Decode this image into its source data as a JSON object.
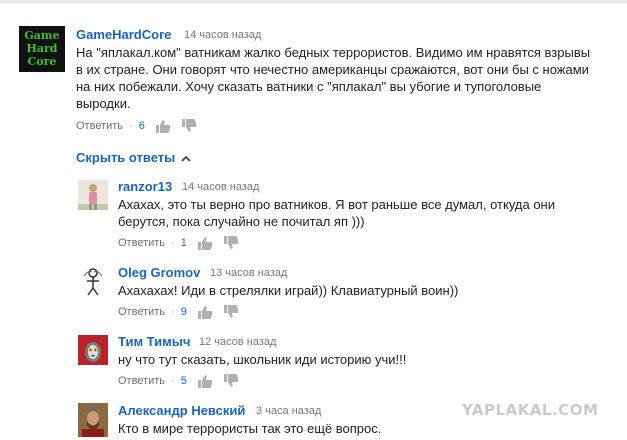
{
  "main_comment": {
    "avatar_text": [
      "Game",
      "Hard",
      "Core"
    ],
    "author": "GameHardCore",
    "time": "14 часов назад",
    "text_lines": [
      "На \"яплакал.ком\" ватникам жалко бедных террористов. Видимо им нравятся взрывы",
      "в их стране. Они говорят что нечестно американцы сражаются, вот они бы с ножами",
      "на них побежали. Хочу сказать ватники с \"яплакал\" вы убогие и тупоголовые",
      "выродки."
    ],
    "reply_label": "Ответить",
    "likes": "6"
  },
  "hide_replies_label": "Скрыть ответы",
  "replies": [
    {
      "author": "ranzor13",
      "time": "14 часов назад",
      "text_lines": [
        "Ахахах, это ты верно про ватников. Я вот раньше все думал, откуда они",
        "берутся, пока случайно не почитал яп )))"
      ],
      "reply_label": "Ответить",
      "likes": "1"
    },
    {
      "author": "Oleg Gromov",
      "time": "13 часов назад",
      "text_lines": [
        "Ахахахах! Иди в стрелялки играй)) Клавиатурный воин))"
      ],
      "reply_label": "Ответить",
      "likes": "9"
    },
    {
      "author": "Тим Тимыч",
      "time": "12 часов назад",
      "text_lines": [
        "ну что тут сказать, школьник иди историю учи!!!"
      ],
      "reply_label": "Ответить",
      "likes": "5"
    },
    {
      "author": "Александр Невский",
      "time": "3 часа назад",
      "text_lines": [
        "Кто в мире террористы так это ещё вопрос."
      ],
      "reply_label": "",
      "likes": ""
    }
  ],
  "watermark": "YAPLAKAL.COM",
  "colors": {
    "author": "#1a66b3",
    "likes": "#1c62b9",
    "avatar_bg": "#111111",
    "avatar_text": "#3fbf2f"
  }
}
